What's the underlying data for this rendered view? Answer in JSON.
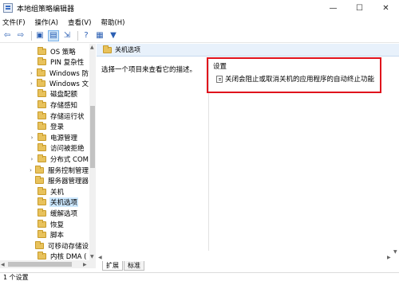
{
  "window": {
    "title": "本地组策略编辑器",
    "minimize": "—",
    "maximize": "☐",
    "close": "✕"
  },
  "menu": [
    {
      "label": "文件(F)"
    },
    {
      "label": "操作(A)"
    },
    {
      "label": "查看(V)"
    },
    {
      "label": "帮助(H)"
    }
  ],
  "toolbar": [
    {
      "icon": "back-arrow-icon",
      "glyph": "⇦"
    },
    {
      "icon": "forward-arrow-icon",
      "glyph": "⇨"
    },
    {
      "icon": "up-folder-icon",
      "glyph": "▣"
    },
    {
      "icon": "show-hide-tree-icon",
      "glyph": "▤"
    },
    {
      "icon": "export-list-icon",
      "glyph": "⇲"
    },
    {
      "icon": "help-icon",
      "glyph": "?"
    },
    {
      "icon": "properties-icon",
      "glyph": "▦"
    },
    {
      "icon": "filter-icon",
      "glyph": "▼"
    }
  ],
  "tree": {
    "items": [
      {
        "label": "OS 策略",
        "expandable": false
      },
      {
        "label": "PIN 复杂性",
        "expandable": false
      },
      {
        "label": "Windows 防",
        "expandable": true
      },
      {
        "label": "Windows 文",
        "expandable": true
      },
      {
        "label": "磁盘配额",
        "expandable": false
      },
      {
        "label": "存储感知",
        "expandable": false
      },
      {
        "label": "存储运行状",
        "expandable": false
      },
      {
        "label": "登录",
        "expandable": false
      },
      {
        "label": "电源管理",
        "expandable": true
      },
      {
        "label": "访问被拒绝",
        "expandable": false
      },
      {
        "label": "分布式 COM",
        "expandable": true
      },
      {
        "label": "服务控制管理",
        "expandable": true
      },
      {
        "label": "服务器管理器",
        "expandable": false
      },
      {
        "label": "关机",
        "expandable": false
      },
      {
        "label": "关机选项",
        "expandable": false,
        "selected": true
      },
      {
        "label": "缓解选项",
        "expandable": false
      },
      {
        "label": "恢复",
        "expandable": false
      },
      {
        "label": "脚本",
        "expandable": false
      },
      {
        "label": "可移动存储设",
        "expandable": false
      },
      {
        "label": "内核 DMA (",
        "expandable": false
      }
    ]
  },
  "right_pane": {
    "header_title": "关机选项",
    "description": "选择一个项目来查看它的描述。",
    "column_header": "设置",
    "settings": [
      {
        "label": "关闭会阻止或取消关机的应用程序的自动终止功能"
      }
    ]
  },
  "tabs": [
    {
      "label": "扩展",
      "active": true
    },
    {
      "label": "标准",
      "active": false
    }
  ],
  "status": {
    "text": "1 个设置"
  },
  "colors": {
    "highlight_border": "#e0121c",
    "selection": "#cce8ff",
    "folder": "#e8c25c"
  }
}
